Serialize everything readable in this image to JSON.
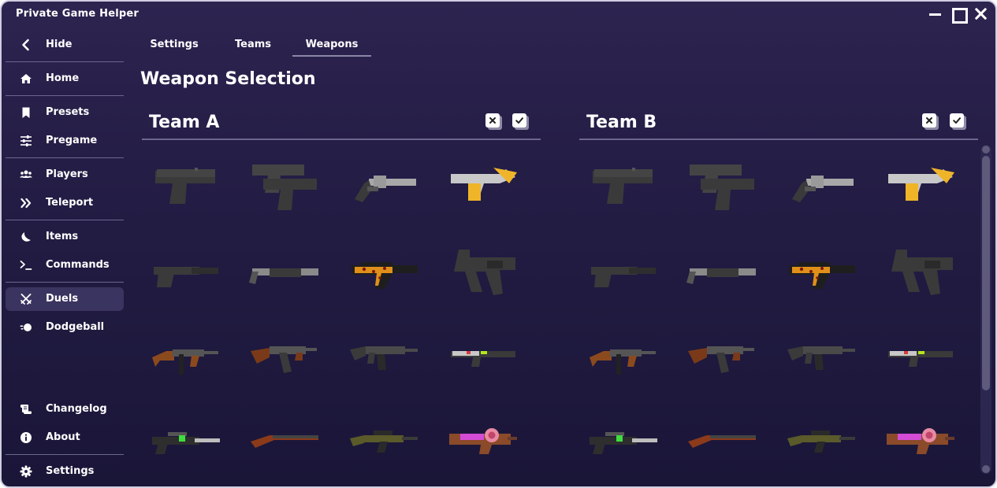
{
  "app": {
    "title": "Private Game Helper"
  },
  "sidebar": {
    "items": [
      {
        "label": "Hide",
        "icon": "chevron-left-icon"
      },
      {
        "label": "Home",
        "icon": "home-icon"
      },
      {
        "label": "Presets",
        "icon": "bookmark-icon"
      },
      {
        "label": "Pregame",
        "icon": "sliders-icon"
      },
      {
        "label": "Players",
        "icon": "users-icon"
      },
      {
        "label": "Teleport",
        "icon": "double-chevron-right-icon"
      },
      {
        "label": "Items",
        "icon": "moon-icon"
      },
      {
        "label": "Commands",
        "icon": "terminal-icon"
      },
      {
        "label": "Duels",
        "icon": "crossed-swords-icon",
        "active": true
      },
      {
        "label": "Dodgeball",
        "icon": "dodgeball-icon"
      },
      {
        "label": "Changelog",
        "icon": "scroll-icon"
      },
      {
        "label": "About",
        "icon": "info-icon"
      },
      {
        "label": "Settings",
        "icon": "gear-icon"
      }
    ]
  },
  "tabs": [
    {
      "label": "Settings"
    },
    {
      "label": "Teams"
    },
    {
      "label": "Weapons",
      "active": true
    }
  ],
  "page": {
    "title": "Weapon Selection"
  },
  "teams": [
    {
      "title": "Team A",
      "deselect_icon": "uncheck-all-icon",
      "select_icon": "check-all-icon"
    },
    {
      "title": "Team B",
      "deselect_icon": "uncheck-all-icon",
      "select_icon": "check-all-icon"
    }
  ],
  "weapons": [
    {
      "icon": "pistol-icon",
      "accent": "#3a3a3a"
    },
    {
      "icon": "dual-pistols-icon",
      "accent": "#3a3a3a"
    },
    {
      "icon": "revolver-icon",
      "accent": "#a8a8a8"
    },
    {
      "icon": "golden-deagle-icon",
      "accent": "#f0b429"
    },
    {
      "icon": "silenced-pistol-icon",
      "accent": "#3a3a3a"
    },
    {
      "icon": "shotgun-icon",
      "accent": "#8a8a8a"
    },
    {
      "icon": "leopard-smg-icon",
      "accent": "#e0901a"
    },
    {
      "icon": "machine-pistol-icon",
      "accent": "#3a3a3a"
    },
    {
      "icon": "tommy-gun-icon",
      "accent": "#8b4a1e"
    },
    {
      "icon": "ak-rifle-icon",
      "accent": "#7a3a1a"
    },
    {
      "icon": "assault-rifle-icon",
      "accent": "#4a4a4a"
    },
    {
      "icon": "scifi-rifle-icon",
      "accent": "#b5e61d"
    },
    {
      "icon": "scoped-rifle-icon",
      "accent": "#3fdc3f"
    },
    {
      "icon": "hunting-rifle-icon",
      "accent": "#8b3a1a"
    },
    {
      "icon": "sniper-rifle-icon",
      "accent": "#5a5a2a"
    },
    {
      "icon": "candy-sniper-icon",
      "accent": "#d44bd6"
    }
  ]
}
